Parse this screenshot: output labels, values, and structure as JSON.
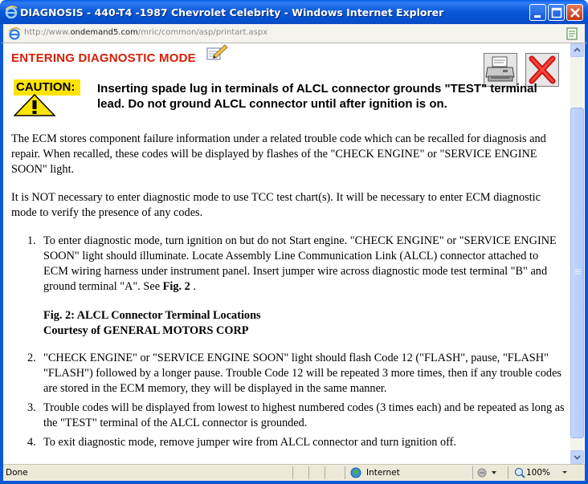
{
  "window": {
    "title": "DIAGNOSIS - 440-T4 -1987 Chevrolet Celebrity - Windows Internet Explorer",
    "controls": [
      "minimize",
      "maximize",
      "close"
    ]
  },
  "address": {
    "prefix": "http://www.",
    "domain": "ondemand5.com",
    "path": "/mric/common/asp/printart.aspx"
  },
  "document": {
    "heading": "ENTERING DIAGNOSTIC MODE",
    "caution_label": "CAUTION:",
    "caution_text": "Inserting spade lug in terminals of ALCL connector grounds \"TEST\" terminal lead. Do not ground ALCL connector until after ignition is on.",
    "para1": "The ECM stores component failure information under a related trouble code which can be recalled for diagnosis and repair. When recalled, these codes will be displayed by flashes of the \"CHECK ENGINE\" or \"SERVICE ENGINE SOON\" light.",
    "para2": "It is NOT necessary to enter diagnostic mode to use TCC test chart(s). It will be necessary to enter ECM diagnostic mode to verify the presence of any codes.",
    "steps": [
      {
        "num": "1.",
        "text_before": "To enter diagnostic mode, turn ignition on but do not Start engine. \"CHECK ENGINE\" or \"SERVICE ENGINE SOON\" light should illuminate. Locate Assembly Line Communication Link (ALCL) connector attached to ECM wiring harness under instrument panel. Insert jumper wire across diagnostic mode test terminal \"B\" and ground terminal \"A\". See ",
        "link": "Fig. 2",
        "text_after": " ."
      },
      {
        "num": "2.",
        "text": "\"CHECK ENGINE\" or \"SERVICE ENGINE SOON\" light should flash Code 12 (\"FLASH\", pause, \"FLASH\" \"FLASH\") followed by a longer pause. Trouble Code 12 will be repeated 3 more times, then if any trouble codes are stored in the ECM memory, they will be displayed in the same manner."
      },
      {
        "num": "3.",
        "text": "Trouble codes will be displayed from lowest to highest numbered codes (3 times each) and be repeated as long as the \"TEST\" terminal of the ALCL connector is grounded."
      },
      {
        "num": "4.",
        "text": "To exit diagnostic mode, remove jumper wire from ALCL connector and turn ignition off."
      }
    ],
    "figure_caption": "Fig. 2: ALCL Connector Terminal Locations",
    "figure_credit": "Courtesy of GENERAL MOTORS CORP"
  },
  "statusbar": {
    "status": "Done",
    "zone": "Internet",
    "zoom": "100%"
  },
  "colors": {
    "heading": "#d81e05",
    "caution_bg": "#ffe400",
    "titlebar": "#0a58d8"
  },
  "icons": [
    "ie-icon",
    "page-icon",
    "pencil-icon",
    "printer-icon",
    "red-x-icon",
    "warning-triangle-icon",
    "globe-icon",
    "protected-mode-icon",
    "zoom-icon"
  ]
}
